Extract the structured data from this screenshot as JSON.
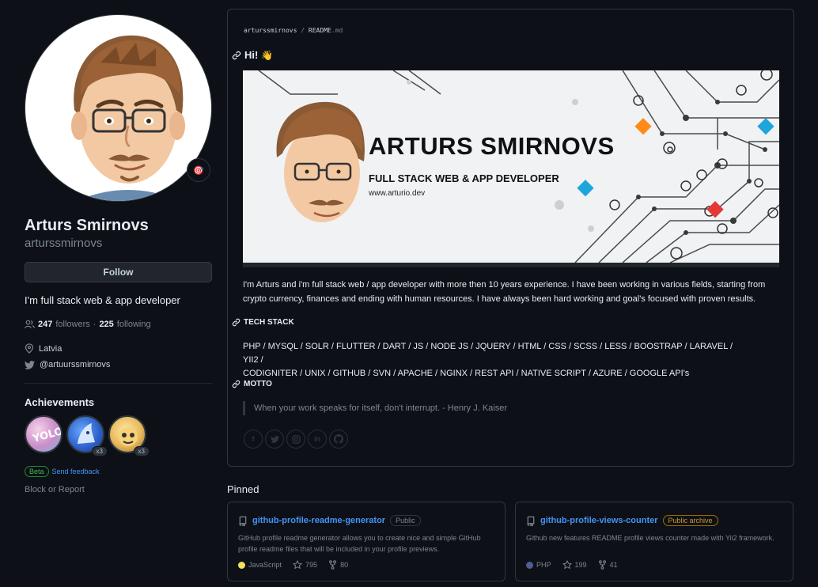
{
  "profile": {
    "name": "Arturs Smirnovs",
    "login": "arturssmirnovs",
    "follow_label": "Follow",
    "bio": "I'm full stack web & app developer",
    "followers_count": "247",
    "followers_label": "followers",
    "separator": "·",
    "following_count": "225",
    "following_label": "following",
    "location": "Latvia",
    "twitter": "@artuurssmirnovs",
    "status_emoji": "🎯"
  },
  "achievements": {
    "title": "Achievements",
    "badges": [
      {
        "name": "YOLO",
        "count": ""
      },
      {
        "name": "Pull Shark",
        "count": "x3"
      },
      {
        "name": "Quickdraw",
        "count": "x3"
      }
    ],
    "beta_label": "Beta",
    "feedback_label": "Send feedback",
    "block_label": "Block or Report"
  },
  "readme": {
    "path_user": "arturssmirnovs",
    "path_sep": "/",
    "path_file": "README",
    "path_ext": ".md",
    "greeting": "Hi!",
    "greeting_emoji": "👋",
    "banner_title": "ARTURS SMIRNOVS",
    "banner_subtitle": "FULL STACK WEB & APP DEVELOPER",
    "banner_url": "www.arturio.dev",
    "intro": "I'm Arturs and i'm full stack web / app developer with more then 10 years experience. I have been working in various fields, starting from crypto currency, finances and ending with human resources. I have always been hard working and goal's focused with proven results.",
    "tech_heading": "TECH STACK",
    "tech_line1": "PHP / MYSQL / SOLR / FLUTTER / DART / JS / NODE JS / JQUERY / HTML / CSS / SCSS / LESS / BOOSTRAP / LARAVEL / YII2 /",
    "tech_line2": "CODIGNITER / UNIX / GITHUB / SVN / APACHE / NGINX / REST API / NATIVE SCRIPT / AZURE / GOOGLE API's",
    "motto_heading": "MOTTO",
    "motto": "When your work speaks for itself, don't interrupt. - Henry J. Kaiser",
    "socials": [
      "facebook-icon",
      "twitter-icon",
      "instagram-icon",
      "linkedin-icon",
      "github-icon"
    ]
  },
  "pinned": {
    "title": "Pinned",
    "repos": [
      {
        "name": "github-profile-readme-generator",
        "visibility": "Public",
        "description": "GitHub profile readme generator allows you to create nice and simple GitHub profile readme files that will be included in your profile previews.",
        "language": "JavaScript",
        "language_color": "#f1e05a",
        "stars": "795",
        "forks": "80"
      },
      {
        "name": "github-profile-views-counter",
        "visibility": "Public archive",
        "description": "Github new features README profile views counter made with Yii2 framework.",
        "language": "PHP",
        "language_color": "#4F5D95",
        "stars": "199",
        "forks": "41"
      }
    ]
  },
  "colors": {
    "background": "#0d1117",
    "border": "#30363d",
    "link": "#4493f8",
    "text": "#e6edf3",
    "muted": "#7d8590"
  }
}
